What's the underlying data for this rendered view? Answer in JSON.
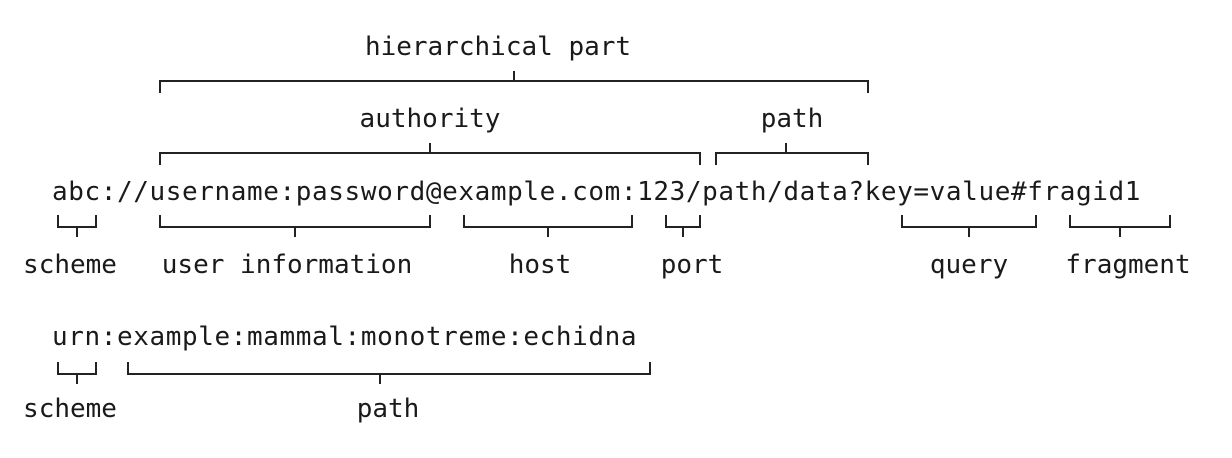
{
  "diagram": {
    "top": {
      "hierarchical_part": "hierarchical part",
      "authority": "authority",
      "path": "path"
    },
    "uri1": {
      "text": "abc://username:password@example.com:123/path/data?key=value#fragid1",
      "labels": {
        "scheme": "scheme",
        "user_information": "user information",
        "host": "host",
        "port": "port",
        "query": "query",
        "fragment": "fragment"
      }
    },
    "uri2": {
      "text": "urn:example:mammal:monotreme:echidna",
      "labels": {
        "scheme": "scheme",
        "path": "path"
      }
    }
  },
  "colors": {
    "background": "#ffffff",
    "ink": "#1a1a1a"
  }
}
